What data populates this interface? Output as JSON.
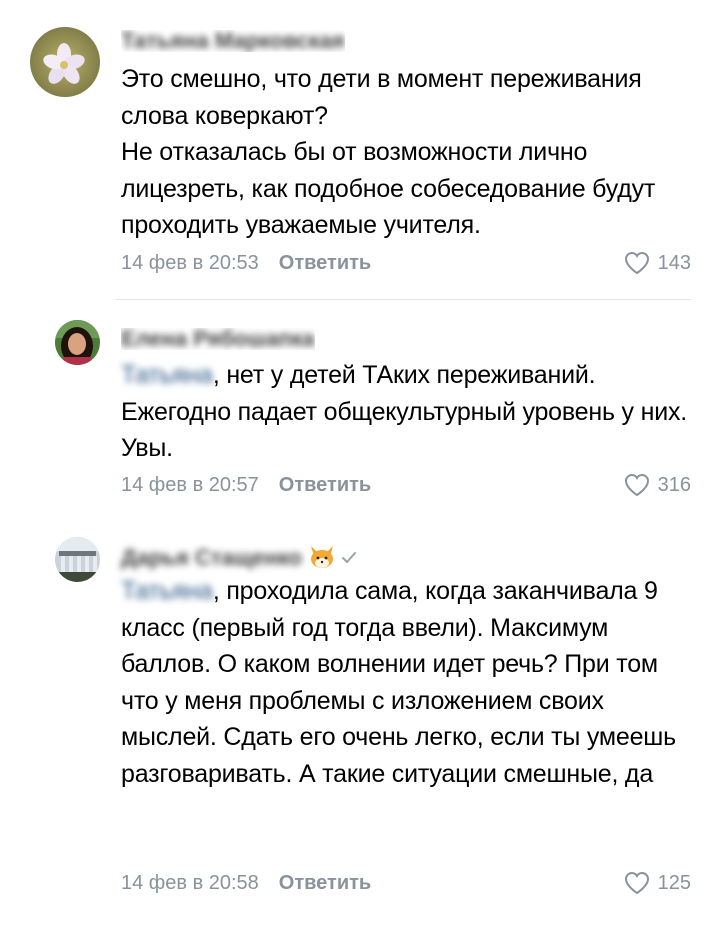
{
  "comments": [
    {
      "author": "Татьяна Марковская",
      "text": "Это смешно, что дети в момент переживания слова коверкают?\nНе отказалась бы от возможности лично лицезреть, как подобное собеседование будут  проходить уважаемые учителя.",
      "date": "14 фев в 20:53",
      "reply_label": "Ответить",
      "likes": "143",
      "avatar_icon": "flower-avatar"
    },
    {
      "author": "Елена Рябошапка",
      "mention": "Татьяна",
      "text": ", нет у детей ТАких переживаний. Ежегодно падает общекультурный уровень у них. Увы.",
      "date": "14 фев в 20:57",
      "reply_label": "Ответить",
      "likes": "316",
      "avatar_icon": "woman-avatar"
    },
    {
      "author": "Дарья Стащенко",
      "mention": "Татьяна",
      "text": ", проходила сама, когда заканчивала 9 класс (первый год тогда ввели). Максимум баллов. О каком волнении идет речь? При том что у меня проблемы с изложением своих мыслей. Сдать его очень легко, если ты умеешь разговаривать. А такие ситуации смешные, да",
      "date": "14 фев в 20:58",
      "reply_label": "Ответить",
      "likes": "125",
      "avatar_icon": "building-avatar",
      "badge_icon": "fox-badge-icon"
    }
  ],
  "colors": {
    "mention": "#2a5885",
    "meta": "#8a929c",
    "divider": "#e1e3e6"
  }
}
